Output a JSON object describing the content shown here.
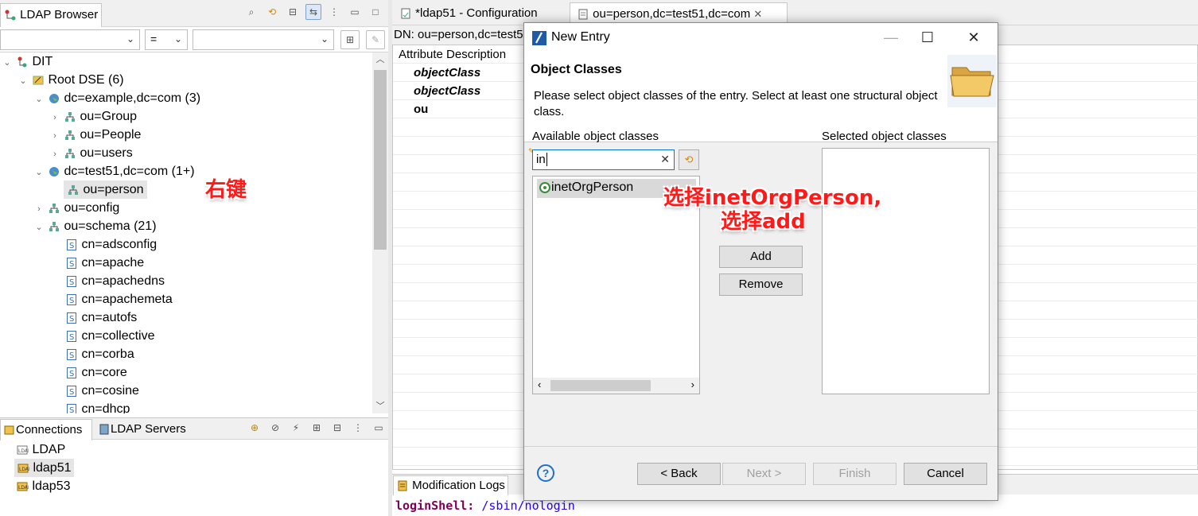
{
  "ldap_browser": {
    "tab_label": "LDAP Browser",
    "filter_operator": "=",
    "tree": [
      {
        "label": "DIT",
        "icon": "dit-icon"
      },
      {
        "label": "Root DSE (6)",
        "icon": "root-dse-icon"
      },
      {
        "label": "dc=example,dc=com (3)",
        "icon": "globe-icon"
      },
      {
        "label": "ou=Group",
        "icon": "ou-icon"
      },
      {
        "label": "ou=People",
        "icon": "ou-icon"
      },
      {
        "label": "ou=users",
        "icon": "ou-icon"
      },
      {
        "label": "dc=test51,dc=com (1+)",
        "icon": "globe-icon"
      },
      {
        "label": "ou=person",
        "icon": "ou-icon"
      },
      {
        "label": "ou=config",
        "icon": "ou-icon"
      },
      {
        "label": "ou=schema (21)",
        "icon": "ou-icon"
      },
      {
        "label": "cn=adsconfig",
        "icon": "schema-icon"
      },
      {
        "label": "cn=apache",
        "icon": "schema-icon"
      },
      {
        "label": "cn=apachedns",
        "icon": "schema-icon"
      },
      {
        "label": "cn=apachemeta",
        "icon": "schema-icon"
      },
      {
        "label": "cn=autofs",
        "icon": "schema-icon"
      },
      {
        "label": "cn=collective",
        "icon": "schema-icon"
      },
      {
        "label": "cn=corba",
        "icon": "schema-icon"
      },
      {
        "label": "cn=core",
        "icon": "schema-icon"
      },
      {
        "label": "cn=cosine",
        "icon": "schema-icon"
      },
      {
        "label": "cn=dhcp",
        "icon": "schema-icon"
      }
    ]
  },
  "connections": {
    "tabs": [
      "Connections",
      "LDAP Servers"
    ],
    "items": [
      "LDAP",
      "ldap51",
      "ldap53"
    ]
  },
  "editor": {
    "tabs": [
      "*ldap51 - Configuration",
      "ou=person,dc=test51,dc=com"
    ],
    "dn": "DN: ou=person,dc=test51,dc=com",
    "column_header": "Attribute Description",
    "rows": [
      "objectClass",
      "objectClass",
      "ou"
    ],
    "mod_logs_tab": "Modification Logs",
    "log_attr": "loginShell:",
    "log_value": " /sbin/nologin"
  },
  "dialog": {
    "title": "New Entry",
    "heading": "Object Classes",
    "description": "Please select object classes of the entry. Select at least one structural object class.",
    "available_label": "Available object classes",
    "selected_label": "Selected object classes",
    "search_value": "in",
    "available_items": [
      "inetOrgPerson"
    ],
    "add_label": "Add",
    "remove_label": "Remove",
    "back_label": "< Back",
    "next_label": "Next >",
    "finish_label": "Finish",
    "cancel_label": "Cancel"
  },
  "annotations": {
    "right_click": "右键",
    "select_line1": "选择inetOrgPerson,",
    "select_line2": "选择add"
  },
  "colors": {
    "annotation": "#ff1a1a",
    "selection": "#e5e5e5",
    "accent_blue": "#0078d7"
  }
}
